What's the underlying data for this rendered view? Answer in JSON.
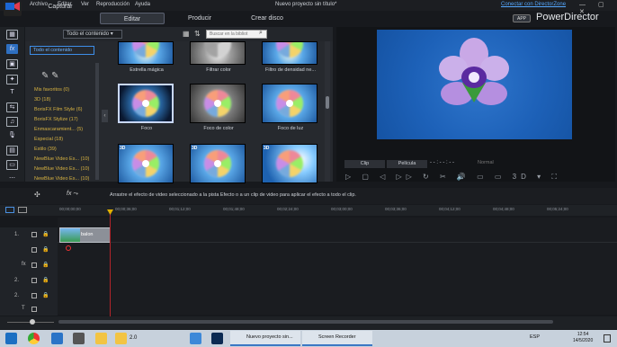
{
  "title_bar": {
    "menu": [
      "Archivo",
      "Editar",
      "Ver",
      "Reproducción",
      "Ayuda"
    ],
    "document_title": "Nuevo proyecto sin título*",
    "connect_link": "Conectar con DirectorZone",
    "window_controls": "— ▢ ✕"
  },
  "mode_tabs": [
    "Capturar",
    "Editar",
    "Producir",
    "Crear disco"
  ],
  "brand": {
    "badge": "APP",
    "name": "PowerDirector"
  },
  "library": {
    "filter": "Todo el contenido ▾",
    "search_placeholder": "Buscar en la bibliot",
    "category_selected": "Todo el contenido",
    "categories": [
      "Mis favoritos  (0)",
      "3D  (18)",
      "BorisFX Film Style  (6)",
      "BorisFX Stylize  (17)",
      "Enmascaramient...  (5)",
      "Especial  (18)",
      "Estilo  (39)",
      "NewBlue Video Es...  (10)",
      "NewBlue Video Es...  (10)",
      "NewBlue Video Es...  (10)"
    ],
    "top_row": [
      "Estrella mágica",
      "Filtrar color",
      "Filtro de densidad ne..."
    ],
    "mid_row": [
      "Foco",
      "Foco de color",
      "Foco de luz"
    ],
    "badge_3d": "3D"
  },
  "preview": {
    "tabs": [
      "Clip",
      "Película"
    ],
    "timecode": "- - : - - : - -",
    "quality": "Normal",
    "toolbar_glyphs": "▷ ▢ ◁ ▷▷ ↻ ✂ 🔊 ▭ ▭ 3D ▾ ⛶",
    "three_d": "3D"
  },
  "info": {
    "message": "Arrastre el efecto de video seleccionado a la pista Efecto o a un clip de video para aplicar el efecto a todo el clip."
  },
  "ruler": [
    "00;00;00;00",
    "00;00;36;00",
    "00;01;12;00",
    "00;01;48;00",
    "00;02;24;00",
    "00;03;00;00",
    "00;03;36;00",
    "00;04;12;00",
    "00;04;48;00",
    "00;05;24;00"
  ],
  "tracks": {
    "labels": [
      "1.",
      "fx",
      "2.",
      "2.",
      "T",
      "♪"
    ],
    "clip_name": "balon"
  },
  "taskbar": {
    "apps": [
      "2.0",
      "Nuevo proyecto sin...",
      "Screen Recorder"
    ],
    "tray": "ESP",
    "time": "12:54",
    "date": "14/5/2020"
  }
}
